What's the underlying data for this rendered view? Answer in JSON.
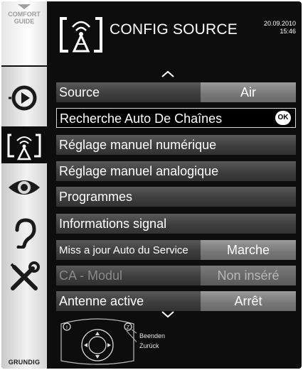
{
  "sidebar": {
    "comfort_guide_line1": "COMFORT",
    "comfort_guide_line2": "GUIDE",
    "icons": [
      "playback-icon",
      "source-config-icon",
      "eye-icon",
      "ear-icon",
      "tools-icon"
    ],
    "brand": "GRUNDIG"
  },
  "header": {
    "title": "CONFIG SOURCE",
    "date": "20.09.2010",
    "time": "15:46"
  },
  "menu": {
    "items": [
      {
        "label": "Source",
        "value": "Air"
      },
      {
        "label": "Recherche Auto De Chaînes",
        "ok_label": "OK"
      },
      {
        "label": "Réglage manuel numérique"
      },
      {
        "label": "Réglage manuel analogique"
      },
      {
        "label": "Programmes"
      },
      {
        "label": "Informations signal"
      },
      {
        "label": "Miss a jour Auto du Service",
        "value": "Marche"
      },
      {
        "label": "CA - Modul",
        "value": "Non inséré"
      },
      {
        "label": "Antenne active",
        "value": "Arrêt"
      }
    ]
  },
  "footer": {
    "back_label": "Beenden",
    "return_label": "Zurück"
  },
  "colors": {
    "background": "#0d0d0d",
    "row": "#3e3e3e",
    "value_cell": "#777777",
    "sidebar": "#e6e6e6"
  }
}
